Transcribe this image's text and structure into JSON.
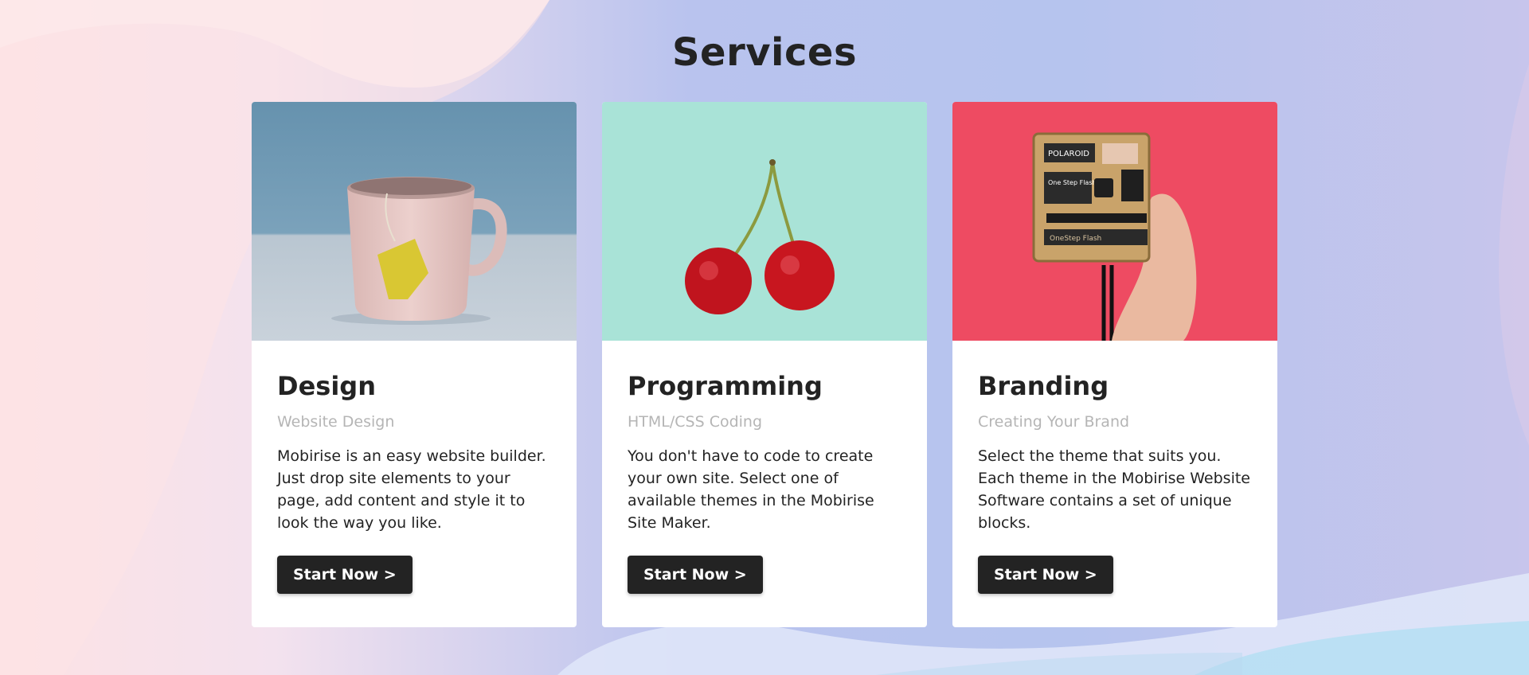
{
  "section": {
    "title": "Services"
  },
  "cards": [
    {
      "title": "Design",
      "subtitle": "Website Design",
      "text": "Mobirise is an easy website builder. Just drop site elements to your page, add content and style it to look the way you like.",
      "button": "Start Now >"
    },
    {
      "title": "Programming",
      "subtitle": "HTML/CSS Coding",
      "text": "You don't have to code to create your own site. Select one of available themes in the Mobirise Site Maker.",
      "button": "Start Now >"
    },
    {
      "title": "Branding",
      "subtitle": "Creating Your Brand",
      "text": "Select the theme that suits you. Each theme in the Mobirise Website Software contains a set of unique blocks.",
      "button": "Start Now >"
    }
  ],
  "images": {
    "camera_brand": "POLAROID",
    "camera_label": "One Step Flash",
    "camera_strip": "OneStep Flash"
  },
  "colors": {
    "text": "#232323",
    "muted": "#b5b5b5",
    "button_bg": "#232323",
    "card_bg": "#ffffff",
    "image1_bg": "#6593ae",
    "image2_bg": "#a8e4d8",
    "image3_bg": "#ee4d63"
  }
}
